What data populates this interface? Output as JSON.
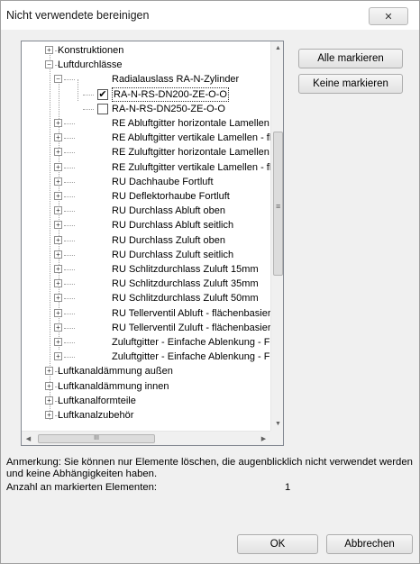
{
  "window": {
    "title": "Nicht verwendete bereinigen",
    "close_label": "✕"
  },
  "tree": {
    "rows": [
      {
        "id": "r0",
        "level": 1,
        "expander": "+",
        "label": "Konstruktionen"
      },
      {
        "id": "r1",
        "level": 1,
        "expander": "−",
        "label": "Luftdurchlässe"
      },
      {
        "id": "r2",
        "level": 2,
        "expander": "−",
        "label": "Radialauslass RA-N-Zylinder"
      },
      {
        "id": "r3",
        "level": 3,
        "checkbox": true,
        "checked": true,
        "selected": true,
        "label": "RA-N-RS-DN200-ZE-O-O"
      },
      {
        "id": "r4",
        "level": 3,
        "checkbox": true,
        "checked": false,
        "label": "RA-N-RS-DN250-ZE-O-O"
      },
      {
        "id": "r5",
        "level": 2,
        "expander": "+",
        "label": "RE Abluftgitter horizontale Lamellen - f"
      },
      {
        "id": "r6",
        "level": 2,
        "expander": "+",
        "label": "RE Abluftgitter vertikale Lamellen - fläc"
      },
      {
        "id": "r7",
        "level": 2,
        "expander": "+",
        "label": "RE Zuluftgitter horizontale Lamellen - f"
      },
      {
        "id": "r8",
        "level": 2,
        "expander": "+",
        "label": "RE Zuluftgitter vertikale Lamellen - fläc"
      },
      {
        "id": "r9",
        "level": 2,
        "expander": "+",
        "label": "RU Dachhaube Fortluft"
      },
      {
        "id": "r10",
        "level": 2,
        "expander": "+",
        "label": "RU Deflektorhaube Fortluft"
      },
      {
        "id": "r11",
        "level": 2,
        "expander": "+",
        "label": "RU Durchlass Abluft oben"
      },
      {
        "id": "r12",
        "level": 2,
        "expander": "+",
        "label": "RU Durchlass Abluft seitlich"
      },
      {
        "id": "r13",
        "level": 2,
        "expander": "+",
        "label": "RU Durchlass Zuluft oben"
      },
      {
        "id": "r14",
        "level": 2,
        "expander": "+",
        "label": "RU Durchlass Zuluft seitlich"
      },
      {
        "id": "r15",
        "level": 2,
        "expander": "+",
        "label": "RU Schlitzdurchlass Zuluft 15mm"
      },
      {
        "id": "r16",
        "level": 2,
        "expander": "+",
        "label": "RU Schlitzdurchlass Zuluft 35mm"
      },
      {
        "id": "r17",
        "level": 2,
        "expander": "+",
        "label": "RU Schlitzdurchlass Zuluft 50mm"
      },
      {
        "id": "r18",
        "level": 2,
        "expander": "+",
        "label": "RU Tellerventil Abluft - flächenbasier..."
      },
      {
        "id": "r19",
        "level": 2,
        "expander": "+",
        "label": "RU Tellerventil Zuluft - flächenbasier..."
      },
      {
        "id": "r20",
        "level": 2,
        "expander": "+",
        "label": "Zuluftgitter - Einfache Ablenkung - Fro"
      },
      {
        "id": "r21",
        "level": 2,
        "expander": "+",
        "label": "Zuluftgitter - Einfache Ablenkung - Fro"
      },
      {
        "id": "r22",
        "level": 1,
        "expander": "+",
        "label": "Luftkanaldämmung außen"
      },
      {
        "id": "r23",
        "level": 1,
        "expander": "+",
        "label": "Luftkanaldämmung innen"
      },
      {
        "id": "r24",
        "level": 1,
        "expander": "+",
        "label": "Luftkanalformteile"
      },
      {
        "id": "r25",
        "level": 1,
        "expander": "+",
        "label": "Luftkanalzubehör"
      }
    ],
    "scroll_grip": "≡",
    "hscroll_grip": "III"
  },
  "buttons": {
    "mark_all": "Alle markieren",
    "mark_none": "Keine markieren",
    "ok": "OK",
    "cancel": "Abbrechen"
  },
  "note": "Anmerkung: Sie können nur Elemente löschen, die augenblicklich nicht verwendet werden und keine Abhängigkeiten haben.",
  "count": {
    "label": "Anzahl an markierten Elementen:",
    "value": "1"
  }
}
